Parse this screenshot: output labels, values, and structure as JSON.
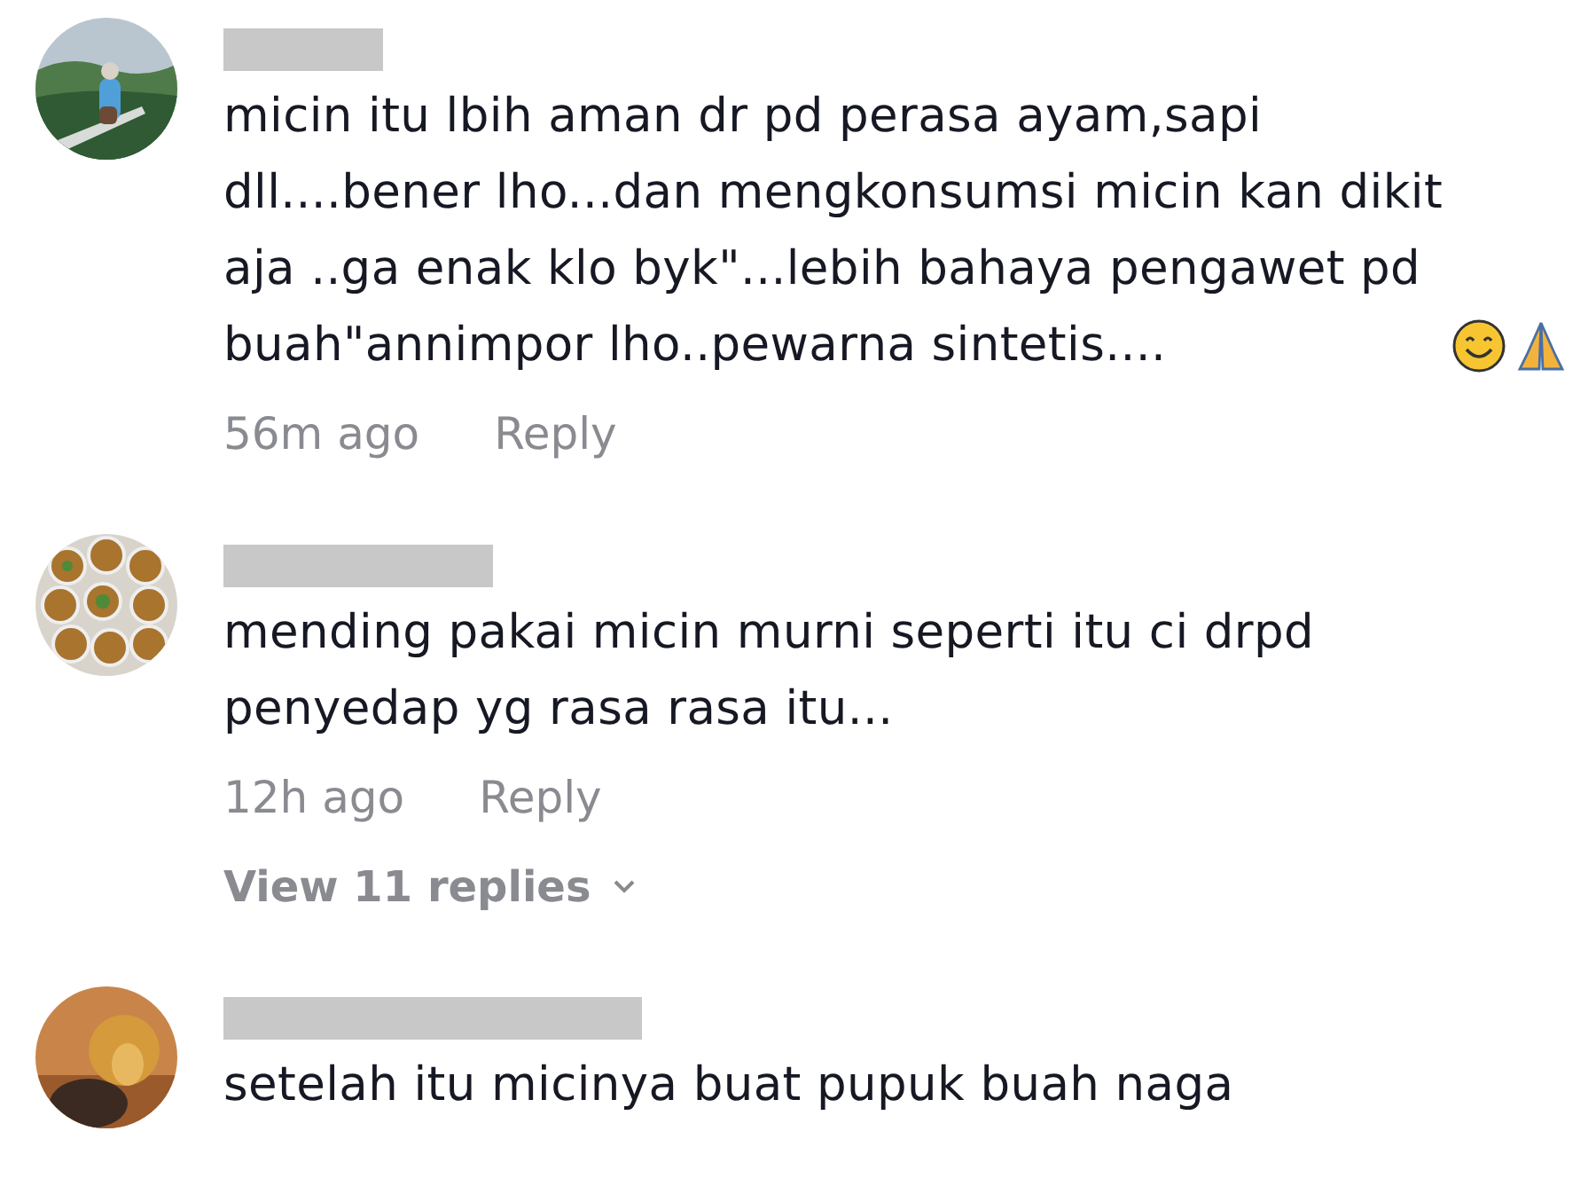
{
  "comments": [
    {
      "text": "micin itu lbih aman dr pd perasa ayam,sapi\ndll....bener lho...dan mengkonsumsi micin kan dikit\naja ..ga enak klo byk\"...lebih bahaya pengawet pd\nbuah\"annimpor lho..pewarna sintetis....",
      "trailing_emoji": true,
      "time": "56m ago",
      "reply": "Reply"
    },
    {
      "text": "mending pakai micin murni seperti itu ci drpd\npenyedap yg rasa rasa itu...",
      "trailing_emoji": false,
      "time": "12h ago",
      "reply": "Reply",
      "view_replies": "View 11 replies"
    },
    {
      "text": "setelah itu micinya buat pupuk buah naga",
      "trailing_emoji": false
    }
  ]
}
